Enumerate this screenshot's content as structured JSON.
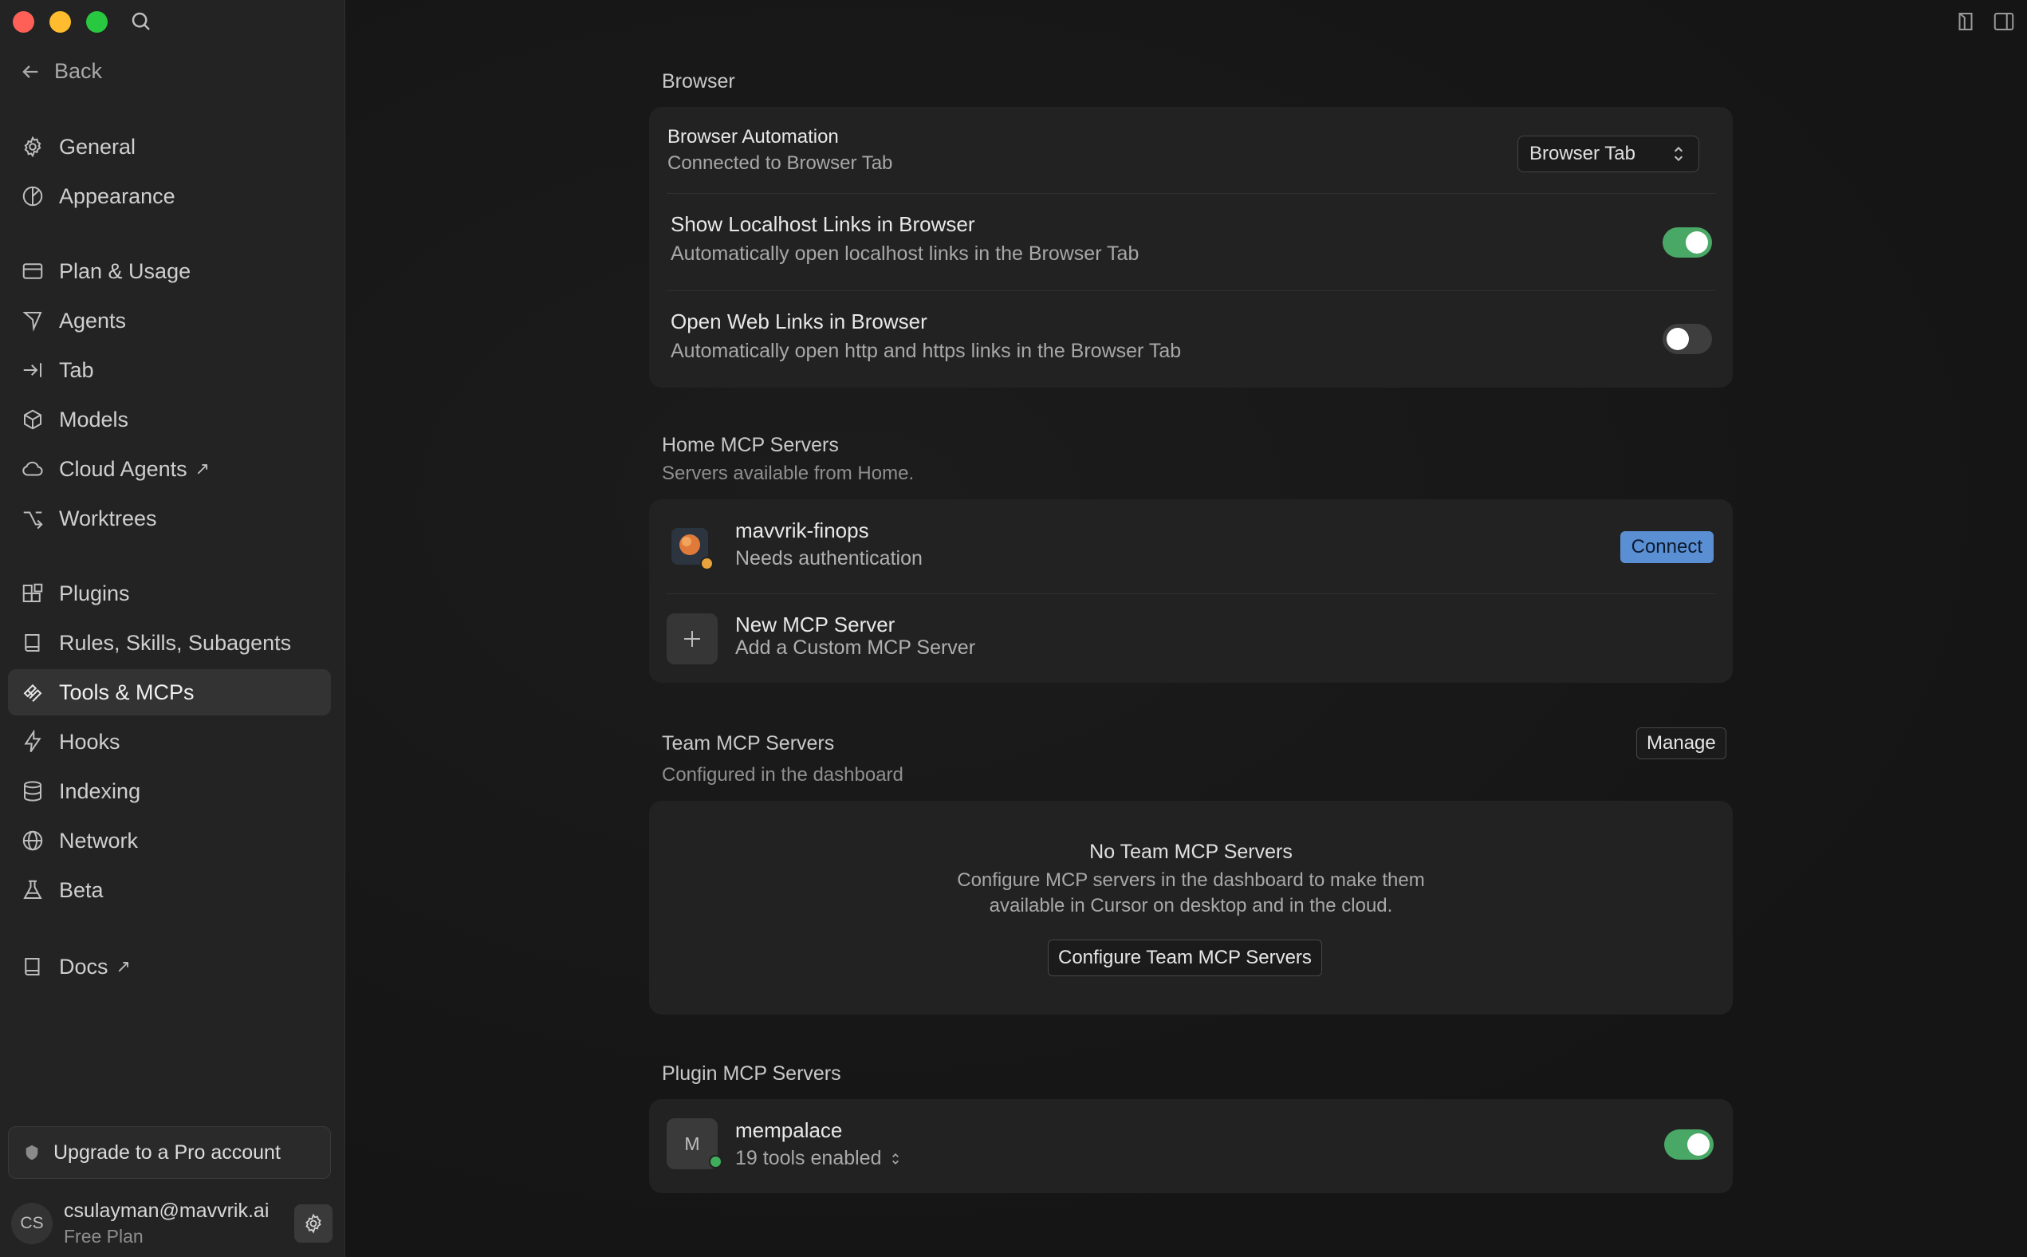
{
  "sidebar": {
    "back_label": "Back",
    "items": [
      {
        "label": "General"
      },
      {
        "label": "Appearance"
      },
      {
        "label": "Plan & Usage"
      },
      {
        "label": "Agents"
      },
      {
        "label": "Tab"
      },
      {
        "label": "Models"
      },
      {
        "label": "Cloud Agents",
        "external": "↗"
      },
      {
        "label": "Worktrees"
      },
      {
        "label": "Plugins"
      },
      {
        "label": "Rules, Skills, Subagents"
      },
      {
        "label": "Tools & MCPs",
        "active": true
      },
      {
        "label": "Hooks"
      },
      {
        "label": "Indexing"
      },
      {
        "label": "Network"
      },
      {
        "label": "Beta"
      },
      {
        "label": "Docs",
        "external": "↗"
      }
    ],
    "upgrade_label": "Upgrade to a Pro account",
    "account": {
      "initials": "CS",
      "email": "csulayman@mavvrik.ai",
      "plan": "Free Plan"
    }
  },
  "browser": {
    "section_title": "Browser",
    "automation": {
      "title": "Browser Automation",
      "subtitle": "Connected to Browser Tab",
      "selected": "Browser Tab"
    },
    "localhost": {
      "title": "Show Localhost Links in Browser",
      "subtitle": "Automatically open localhost links in the Browser Tab",
      "enabled": true
    },
    "weblinks": {
      "title": "Open Web Links in Browser",
      "subtitle": "Automatically open http and https links in the Browser Tab",
      "enabled": false
    }
  },
  "home_mcp": {
    "section_title": "Home MCP Servers",
    "section_subtitle": "Servers available from Home.",
    "servers": [
      {
        "name": "mavvrik-finops",
        "status": "Needs authentication",
        "action": "Connect"
      }
    ],
    "new_server": {
      "title": "New MCP Server",
      "subtitle": "Add a Custom MCP Server"
    }
  },
  "team_mcp": {
    "section_title": "Team MCP Servers",
    "section_subtitle": "Configured in the dashboard",
    "manage_label": "Manage",
    "empty_title": "No Team MCP Servers",
    "empty_line1": "Configure MCP servers in the dashboard to make them",
    "empty_line2": "available in Cursor on desktop and in the cloud.",
    "configure_label": "Configure Team MCP Servers"
  },
  "plugin_mcp": {
    "section_title": "Plugin MCP Servers",
    "servers": [
      {
        "initial": "M",
        "name": "mempalace",
        "tools": "19 tools enabled",
        "enabled": true
      }
    ]
  },
  "colors": {
    "accent_blue": "#5a8fd4",
    "toggle_on": "#4aa866",
    "status_orange": "#e8a33a",
    "status_green": "#3fae5a"
  }
}
